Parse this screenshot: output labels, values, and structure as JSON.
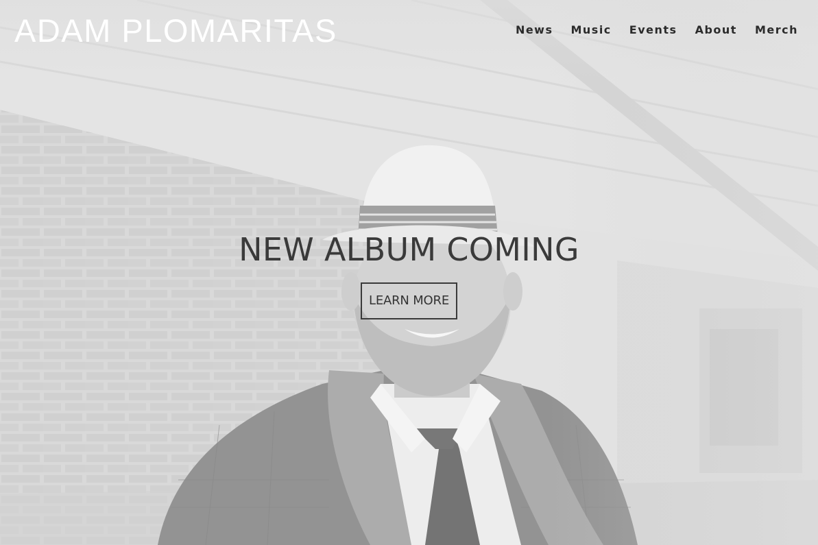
{
  "site": {
    "title": "ADAM PLOMARITAS"
  },
  "nav": {
    "items": [
      {
        "label": "News"
      },
      {
        "label": "Music"
      },
      {
        "label": "Events"
      },
      {
        "label": "About"
      },
      {
        "label": "Merch"
      }
    ]
  },
  "hero": {
    "headline": "NEW ALBUM COMING",
    "cta_label": "LEARN MORE",
    "image_description": "Grayscale photo of a smiling bearded man in a fedora hat, plaid suit jacket, scarf and tie, standing beside a brick wall"
  }
}
